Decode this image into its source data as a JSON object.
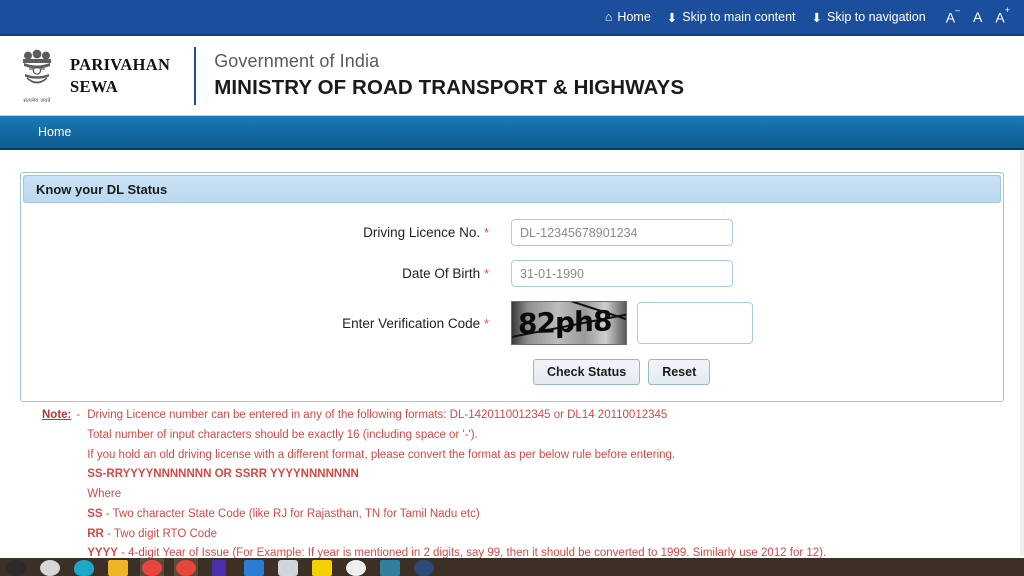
{
  "topbar": {
    "home_label": "Home",
    "skip_main_label": "Skip to main content",
    "skip_nav_label": "Skip to navigation",
    "font_decrease": "A",
    "font_normal": "A",
    "font_increase": "A",
    "bg_color": "#1b4f9c"
  },
  "header": {
    "brand_line1": "PARIVAHAN",
    "brand_line2": "SEWA",
    "emblem_motto": "सत्यमेव जयते",
    "gov_line": "Government of India",
    "ministry_line": "MINISTRY OF ROAD TRANSPORT & HIGHWAYS"
  },
  "nav": {
    "items": [
      {
        "label": "Home"
      }
    ]
  },
  "panel": {
    "title": "Know your DL Status",
    "fields": [
      {
        "label": "Driving Licence No.",
        "required": "*",
        "value": "",
        "placeholder": "DL-12345678901234"
      },
      {
        "label": "Date Of Birth",
        "required": "*",
        "value": "",
        "placeholder": "31-01-1990"
      }
    ],
    "captcha": {
      "label": "Enter Verification Code",
      "required": "*",
      "code_text": "82ph8",
      "input_value": "",
      "input_placeholder": ""
    },
    "buttons": {
      "submit_label": "Check Status",
      "reset_label": "Reset"
    }
  },
  "notes": {
    "label": "Note:",
    "dash": "-",
    "lines": [
      "Driving Licence number can be entered in any of the following formats: DL-1420110012345 or DL14 20110012345",
      "Total number of input characters should be exactly 16 (including space or '-').",
      "If you hold an old driving license with a different format, please convert the format as per below rule before entering."
    ],
    "format_rule": "SS-RRYYYYNNNNNNN OR SSRR YYYYNNNNNNN",
    "where_label": "Where",
    "definitions": [
      {
        "code": "SS",
        "text": " - Two character State Code (like RJ for Rajasthan, TN for Tamil Nadu etc)"
      },
      {
        "code": "RR",
        "text": " - Two digit RTO Code"
      },
      {
        "code": "YYYY",
        "text": " - 4-digit Year of Issue (For Example: If year is mentioned in 2 digits, say 99, then it should be converted to 1999. Similarly use 2012 for 12)."
      }
    ],
    "text_color": "#d24a46"
  },
  "taskbar": {
    "items": [
      {
        "name": "taskbar-start-icon",
        "color": "#2b2b2b"
      },
      {
        "name": "taskbar-search-icon",
        "color": "#d8d8d8"
      },
      {
        "name": "taskbar-edge-icon",
        "color": "#1ba9c9"
      },
      {
        "name": "taskbar-file-explorer-icon",
        "color": "#f0b429"
      },
      {
        "name": "taskbar-chrome-icon",
        "color": "#e8453c"
      },
      {
        "name": "taskbar-chrome-active-icon",
        "color": "#e8453c"
      },
      {
        "name": "taskbar-app-purple-icon",
        "color": "#4b2fa8"
      },
      {
        "name": "taskbar-app-blue-icon",
        "color": "#2b7cd3"
      },
      {
        "name": "taskbar-app-grey-icon",
        "color": "#cfd6dc"
      },
      {
        "name": "taskbar-app-yellow-icon",
        "color": "#f5d000"
      },
      {
        "name": "taskbar-app-white-icon",
        "color": "#efefef"
      },
      {
        "name": "taskbar-app-teal-icon",
        "color": "#2f7f9f"
      },
      {
        "name": "taskbar-app-navy-icon",
        "color": "#2c4a78"
      }
    ]
  }
}
